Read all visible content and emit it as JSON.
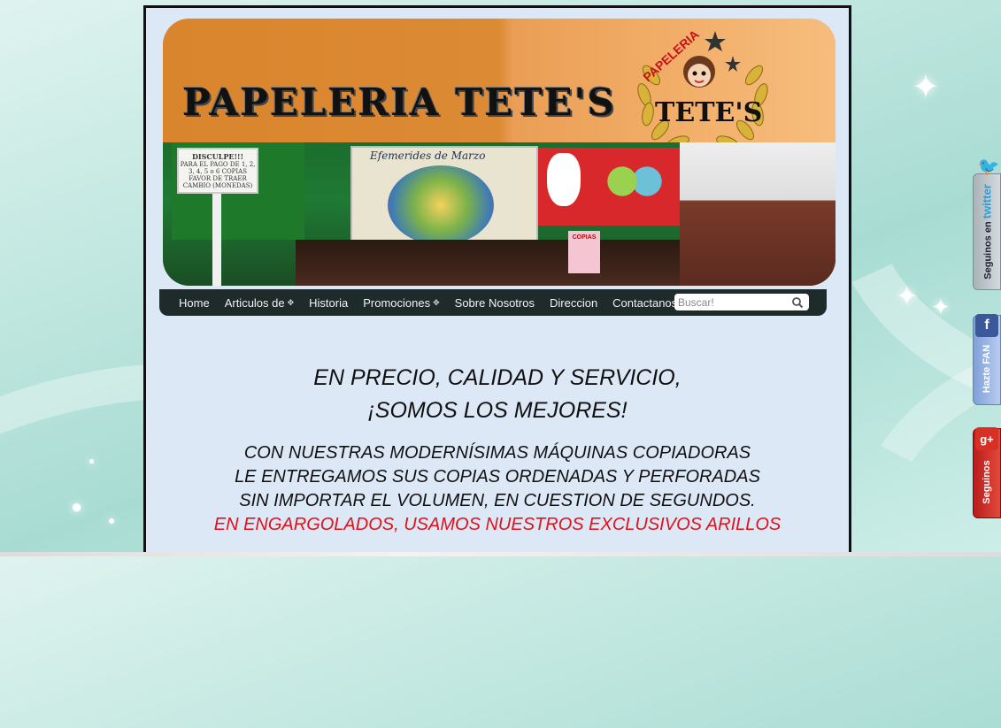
{
  "banner": {
    "title": "PAPELERIA TETE'S",
    "logo_top": "PAPELERIA",
    "logo_name": "TETE'S",
    "sign_title": "DISCULPE!!!",
    "sign_text": "PARA EL PAGO DE 1, 2, 3, 4, 5 o 6 COPIAS FAVOR DE TRAER CAMBIO (MONEDAS)",
    "poster_title": "Efemerides de Marzo",
    "copias_sign": "COPIAS"
  },
  "nav": {
    "items": [
      {
        "label": "Home",
        "has_submenu": false
      },
      {
        "label": "Articulos de",
        "has_submenu": true
      },
      {
        "label": "Historia",
        "has_submenu": false
      },
      {
        "label": "Promociones",
        "has_submenu": true
      },
      {
        "label": "Sobre Nosotros",
        "has_submenu": false
      },
      {
        "label": "Direccion",
        "has_submenu": false
      },
      {
        "label": "Contactanos",
        "has_submenu": false
      }
    ],
    "search_placeholder": "Buscar!"
  },
  "content": {
    "headline": [
      "EN PRECIO, CALIDAD Y SERVICIO,",
      "¡SOMOS LOS MEJORES!"
    ],
    "body": [
      {
        "text": "CON NUESTRAS MODERNÍSIMAS MÁQUINAS COPIADORAS",
        "color": "black"
      },
      {
        "text": "LE ENTREGAMOS SUS COPIAS ORDENADAS Y PERFORADAS",
        "color": "black"
      },
      {
        "text": "SIN IMPORTAR EL VOLUMEN, EN CUESTION DE SEGUNDOS.",
        "color": "black"
      },
      {
        "text": "EN ENGARGOLADOS, USAMOS NUESTROS EXCLUSIVOS ARILLOS",
        "color": "red"
      }
    ]
  },
  "social": {
    "twitter": {
      "prefix": "Seguinos en",
      "brand": "twitter"
    },
    "facebook": {
      "label": "Hazte FAN",
      "icon_letter": "f"
    },
    "googleplus": {
      "label": "Seguinos",
      "icon_letter": "g+"
    }
  },
  "colors": {
    "accent_red": "#e3101a",
    "nav_bg": "#1f2a2a",
    "page_bg": "#dde8f7",
    "banner_orange": "#d9852d"
  }
}
